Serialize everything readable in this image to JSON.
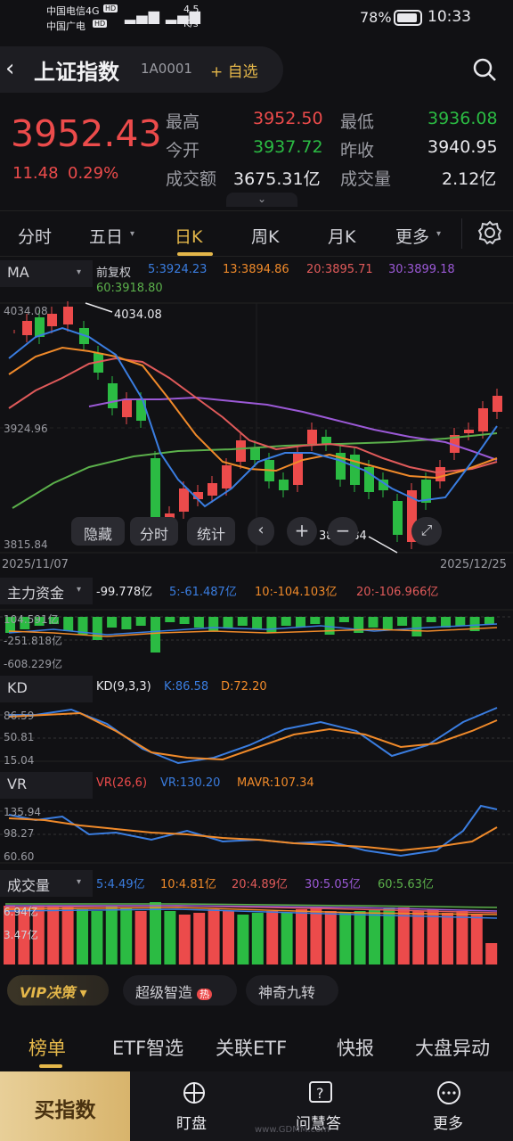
{
  "status": {
    "carrier1": "中国电信4G",
    "carrier2": "中国广电",
    "hd": "HD",
    "net": "4.5",
    "unit": "K/s",
    "battery": "78%",
    "time": "10:33"
  },
  "header": {
    "title": "上证指数",
    "code": "1A0001",
    "add": "+ 自选"
  },
  "quote": {
    "price": "3952.43",
    "change": "11.48",
    "pct": "0.29%",
    "high_label": "最高",
    "high": "3952.50",
    "low_label": "最低",
    "low": "3936.08",
    "open_label": "今开",
    "open": "3937.72",
    "prev_label": "昨收",
    "prev": "3940.95",
    "amount_label": "成交额",
    "amount": "3675.31亿",
    "volume_label": "成交量",
    "volume": "2.12亿"
  },
  "tabs": [
    "分时",
    "五日",
    "日K",
    "周K",
    "月K",
    "更多"
  ],
  "ma": {
    "label": "MA",
    "fq": "前复权",
    "ma5": "5:3924.23",
    "ma13": "13:3894.86",
    "ma20": "20:3895.71",
    "ma30": "30:3899.18",
    "ma60": "60:3918.80",
    "y_top": "4034.08",
    "y_mid": "3924.96",
    "y_bot": "3815.84",
    "hi_mark": "4034.08",
    "lo_mark": "3815.84",
    "date_start": "2025/11/07",
    "date_end": "2025/12/25",
    "btn_hide": "隐藏",
    "btn_time": "分时",
    "btn_stat": "统计"
  },
  "funds": {
    "label": "主力资金",
    "v": "-99.778亿",
    "v5": "5:-61.487亿",
    "v10": "10:-104.103亿",
    "v20": "20:-106.966亿",
    "y1": "104.591亿",
    "y2": "-251.818亿",
    "y3": "-608.229亿"
  },
  "kd": {
    "label": "KD",
    "param": "KD(9,3,3)",
    "k": "K:86.58",
    "d": "D:72.20",
    "y1": "86.59",
    "y2": "50.81",
    "y3": "15.04"
  },
  "vr": {
    "label": "VR",
    "param": "VR(26,6)",
    "vr": "VR:130.20",
    "mavr": "MAVR:107.34",
    "y1": "135.94",
    "y2": "98.27",
    "y3": "60.60"
  },
  "vol": {
    "label": "成交量",
    "v5": "5:4.49亿",
    "v10": "10:4.81亿",
    "v20": "20:4.89亿",
    "v30": "30:5.05亿",
    "v60": "60:5.63亿",
    "y1": "6.94亿",
    "y2": "3.47亿"
  },
  "strategy": {
    "vip": "VIP决策",
    "b1": "超级智造",
    "hot": "热",
    "b2": "神奇九转"
  },
  "bottom_tabs": [
    "榜单",
    "ETF智选",
    "关联ETF",
    "快报",
    "大盘异动"
  ],
  "bottom": {
    "buy": "买指数",
    "watch": "盯盘",
    "ask": "问慧答",
    "more": "更多",
    "watermark": "www.GDMM.com"
  },
  "colors": {
    "up": "#ec4b4b",
    "down": "#2bbb43",
    "gold": "#e4b74a",
    "ma5": "#3a7de0",
    "ma10": "#f08a2a",
    "ma20": "#e05a5a",
    "ma30": "#9b59d6",
    "ma60": "#5bb04b"
  }
}
